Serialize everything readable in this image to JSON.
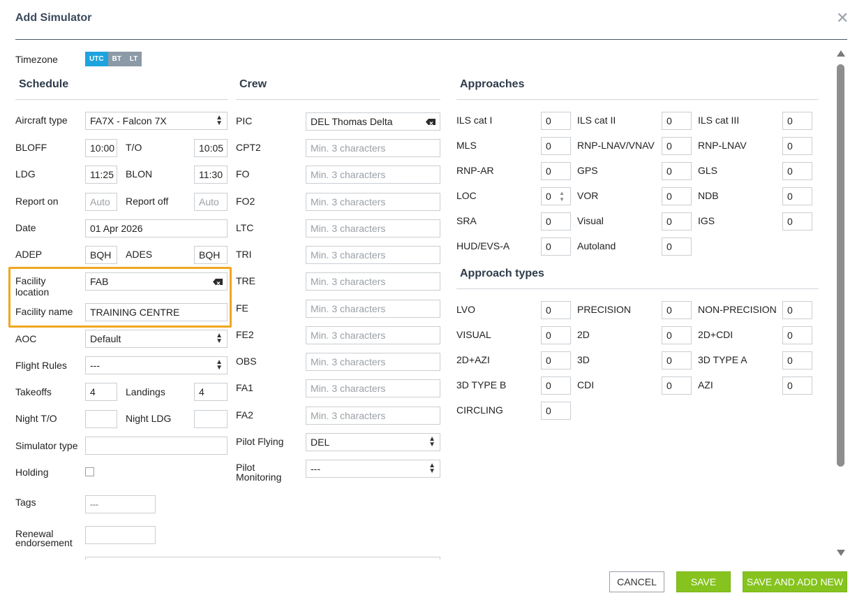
{
  "dialog": {
    "title": "Add Simulator"
  },
  "timezone": {
    "label": "Timezone",
    "options": [
      "UTC",
      "BT",
      "LT"
    ],
    "active": "UTC"
  },
  "schedule": {
    "heading": "Schedule",
    "aircraft_type": {
      "label": "Aircraft type",
      "value": "FA7X - Falcon 7X"
    },
    "bloff": {
      "label": "BLOFF",
      "value": "10:00"
    },
    "to": {
      "label": "T/O",
      "value": "10:05"
    },
    "ldg": {
      "label": "LDG",
      "value": "11:25"
    },
    "blon": {
      "label": "BLON",
      "value": "11:30"
    },
    "report_on": {
      "label": "Report on",
      "placeholder": "Auto"
    },
    "report_off": {
      "label": "Report off",
      "placeholder": "Auto"
    },
    "date": {
      "label": "Date",
      "value": "01 Apr 2026"
    },
    "adep": {
      "label": "ADEP",
      "value": "BQH"
    },
    "ades": {
      "label": "ADES",
      "value": "BQH"
    },
    "facility_location": {
      "label_1": "Facility",
      "label_2": "location",
      "value": "FAB"
    },
    "facility_name": {
      "label": "Facility name",
      "value": "TRAINING CENTRE"
    },
    "aoc": {
      "label": "AOC",
      "value": "Default"
    },
    "flight_rules": {
      "label": "Flight Rules",
      "value": "---"
    },
    "takeoffs": {
      "label": "Takeoffs",
      "value": "4"
    },
    "landings": {
      "label": "Landings",
      "value": "4"
    },
    "night_to": {
      "label": "Night T/O",
      "value": ""
    },
    "night_ldg": {
      "label": "Night LDG",
      "value": ""
    },
    "simulator_type": {
      "label": "Simulator type",
      "value": ""
    },
    "holding": {
      "label": "Holding"
    },
    "tags": {
      "label": "Tags",
      "value": "---"
    },
    "renewal": {
      "label_1": "Renewal",
      "label_2": "endorsement",
      "value": ""
    }
  },
  "crew": {
    "heading": "Crew",
    "placeholder": "Min. 3 characters",
    "pic": {
      "label": "PIC",
      "value": "DEL Thomas Delta"
    },
    "roles": [
      "CPT2",
      "FO",
      "FO2",
      "LTC",
      "TRI",
      "TRE",
      "FE",
      "FE2",
      "OBS",
      "FA1",
      "FA2"
    ],
    "pilot_flying": {
      "label": "Pilot Flying",
      "value": "DEL"
    },
    "pilot_monitoring": {
      "label_1": "Pilot",
      "label_2": "Monitoring",
      "value": "---"
    }
  },
  "approaches": {
    "heading": "Approaches",
    "items": [
      {
        "label": "ILS cat I",
        "value": "0"
      },
      {
        "label": "ILS cat II",
        "value": "0"
      },
      {
        "label": "ILS cat III",
        "value": "0"
      },
      {
        "label": "MLS",
        "value": "0"
      },
      {
        "label": "RNP-LNAV/VNAV",
        "value": "0"
      },
      {
        "label": "RNP-LNAV",
        "value": "0"
      },
      {
        "label": "RNP-AR",
        "value": "0"
      },
      {
        "label": "GPS",
        "value": "0"
      },
      {
        "label": "GLS",
        "value": "0"
      },
      {
        "label": "LOC",
        "value": "0"
      },
      {
        "label": "VOR",
        "value": "0"
      },
      {
        "label": "NDB",
        "value": "0"
      },
      {
        "label": "SRA",
        "value": "0"
      },
      {
        "label": "Visual",
        "value": "0"
      },
      {
        "label": "IGS",
        "value": "0"
      },
      {
        "label": "HUD/EVS-A",
        "value": "0"
      },
      {
        "label": "Autoland",
        "value": "0"
      }
    ]
  },
  "approach_types": {
    "heading": "Approach types",
    "items": [
      {
        "label": "LVO",
        "value": "0"
      },
      {
        "label": "PRECISION",
        "value": "0"
      },
      {
        "label": "NON-PRECISION",
        "value": "0"
      },
      {
        "label": "VISUAL",
        "value": "0"
      },
      {
        "label": "2D",
        "value": "0"
      },
      {
        "label": "2D+CDI",
        "value": "0"
      },
      {
        "label": "2D+AZI",
        "value": "0"
      },
      {
        "label": "3D",
        "value": "0"
      },
      {
        "label": "3D TYPE A",
        "value": "0"
      },
      {
        "label": "3D TYPE B",
        "value": "0"
      },
      {
        "label": "CDI",
        "value": "0"
      },
      {
        "label": "AZI",
        "value": "0"
      },
      {
        "label": "CIRCLING",
        "value": "0"
      }
    ]
  },
  "footer": {
    "cancel": "CANCEL",
    "save": "SAVE",
    "save_and_add_new": "SAVE AND ADD NEW"
  },
  "colors": {
    "accent": "#1fa3df",
    "save": "#86c31e",
    "highlight": "#f0a71f"
  }
}
